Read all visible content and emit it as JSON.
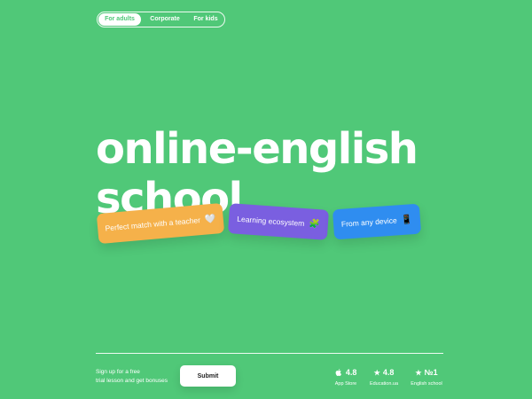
{
  "nav": {
    "tabs": [
      {
        "label": "For adults",
        "active": true
      },
      {
        "label": "Corporate",
        "active": false
      },
      {
        "label": "For kids",
        "active": false
      }
    ]
  },
  "hero": {
    "line1": "online-english",
    "line2": "school"
  },
  "features": [
    {
      "label": "Perfect match with a teacher",
      "emoji": "🤍",
      "color": "#f5b14a"
    },
    {
      "label": "Learning ecosystem",
      "emoji": "🧩",
      "color": "#7a5fe0"
    },
    {
      "label": "From any device",
      "emoji": "📱",
      "color": "#2f8df0"
    }
  ],
  "signup": {
    "text_line1": "Sign up for a free",
    "text_line2": "trial lesson and get bonuses",
    "submit_label": "Submit"
  },
  "ratings": [
    {
      "icon": "apple-icon",
      "glyph": "",
      "value": "4.8",
      "label": "App Store"
    },
    {
      "icon": "star-icon",
      "glyph": "★",
      "value": "4.8",
      "label": "Education.ua"
    },
    {
      "icon": "star-icon",
      "glyph": "★",
      "value": "№1",
      "label": "English school"
    }
  ],
  "colors": {
    "background": "#50c878",
    "accent_orange": "#f5b14a",
    "accent_purple": "#7a5fe0",
    "accent_blue": "#2f8df0"
  }
}
